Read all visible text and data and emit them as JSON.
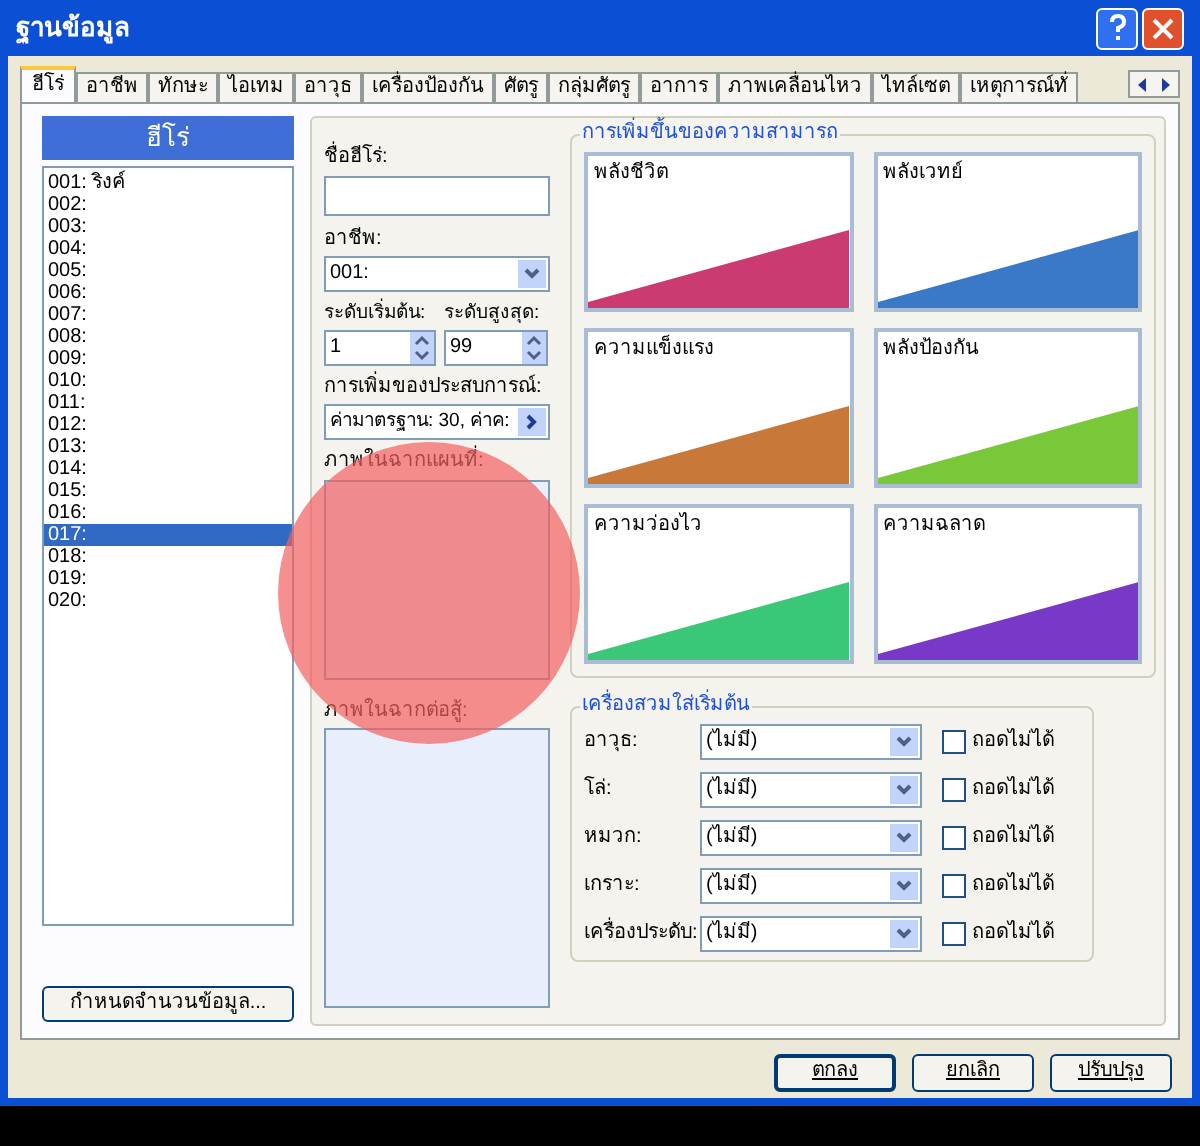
{
  "window": {
    "title": "ฐานข้อมูล"
  },
  "tabs": [
    {
      "label": "ฮีโร่",
      "selected": true
    },
    {
      "label": "อาชีพ",
      "selected": false
    },
    {
      "label": "ทักษะ",
      "selected": false
    },
    {
      "label": "ไอเทม",
      "selected": false
    },
    {
      "label": "อาวุธ",
      "selected": false
    },
    {
      "label": "เครื่องป้องกัน",
      "selected": false
    },
    {
      "label": "ศัตรู",
      "selected": false
    },
    {
      "label": "กลุ่มศัตรู",
      "selected": false
    },
    {
      "label": "อาการ",
      "selected": false
    },
    {
      "label": "ภาพเคลื่อนไหว",
      "selected": false
    },
    {
      "label": "ไทล์เซต",
      "selected": false
    },
    {
      "label": "เหตุการณ์ทั่",
      "selected": false
    }
  ],
  "hero_list": {
    "title": "ฮีโร่",
    "items": [
      {
        "label": "001: ริงค์",
        "selected": false
      },
      {
        "label": "002:",
        "selected": false
      },
      {
        "label": "003:",
        "selected": false
      },
      {
        "label": "004:",
        "selected": false
      },
      {
        "label": "005:",
        "selected": false
      },
      {
        "label": "006:",
        "selected": false
      },
      {
        "label": "007:",
        "selected": false
      },
      {
        "label": "008:",
        "selected": false
      },
      {
        "label": "009:",
        "selected": false
      },
      {
        "label": "010:",
        "selected": false
      },
      {
        "label": "011:",
        "selected": false
      },
      {
        "label": "012:",
        "selected": false
      },
      {
        "label": "013:",
        "selected": false
      },
      {
        "label": "014:",
        "selected": false
      },
      {
        "label": "015:",
        "selected": false
      },
      {
        "label": "016:",
        "selected": false
      },
      {
        "label": "017:",
        "selected": true
      },
      {
        "label": "018:",
        "selected": false
      },
      {
        "label": "019:",
        "selected": false
      },
      {
        "label": "020:",
        "selected": false
      }
    ],
    "button": "กำหนดจำนวนข้อมูล..."
  },
  "form": {
    "name_label": "ชื่อฮีโร่:",
    "class_label": "อาชีพ:",
    "class_value": "001:",
    "initial_level_label": "ระดับเริ่มต้น:",
    "initial_level": "1",
    "max_level_label": "ระดับสูงสุด:",
    "max_level": "99",
    "exp_label": "การเพิ่มของประสบการณ์:",
    "exp_value": "ค่ามาตรฐาน: 30, ค่าค:",
    "map_graphic_label": "ภาพในฉากแผนที่:",
    "battle_graphic_label": "ภาพในฉากต่อสู้:"
  },
  "parameters": {
    "title": "การเพิ่มขึ้นของความสามารถ",
    "items": [
      {
        "label": "พลังชีวิต",
        "color": "#cc3a72"
      },
      {
        "label": "พลังเวทย์",
        "color": "#3a78c8"
      },
      {
        "label": "ความแข็งแรง",
        "color": "#c87838"
      },
      {
        "label": "พลังป้องกัน",
        "color": "#78c83a"
      },
      {
        "label": "ความว่องไว",
        "color": "#3ac878"
      },
      {
        "label": "ความฉลาด",
        "color": "#7838c8"
      }
    ]
  },
  "equipment": {
    "title": "เครื่องสวมใส่เริ่มต้น",
    "slots": [
      {
        "label": "อาวุธ:",
        "value": "(ไม่มี)",
        "fixed_label": "ถอดไม่ได้",
        "checked": false
      },
      {
        "label": "โล่:",
        "value": "(ไม่มี)",
        "fixed_label": "ถอดไม่ได้",
        "checked": false
      },
      {
        "label": "หมวก:",
        "value": "(ไม่มี)",
        "fixed_label": "ถอดไม่ได้",
        "checked": false
      },
      {
        "label": "เกราะ:",
        "value": "(ไม่มี)",
        "fixed_label": "ถอดไม่ได้",
        "checked": false
      },
      {
        "label": "เครื่องประดับ:",
        "value": "(ไม่มี)",
        "fixed_label": "ถอดไม่ได้",
        "checked": false
      }
    ]
  },
  "buttons": [
    "ตกลง",
    "ยกเลิก",
    "ปรับปรุง"
  ]
}
